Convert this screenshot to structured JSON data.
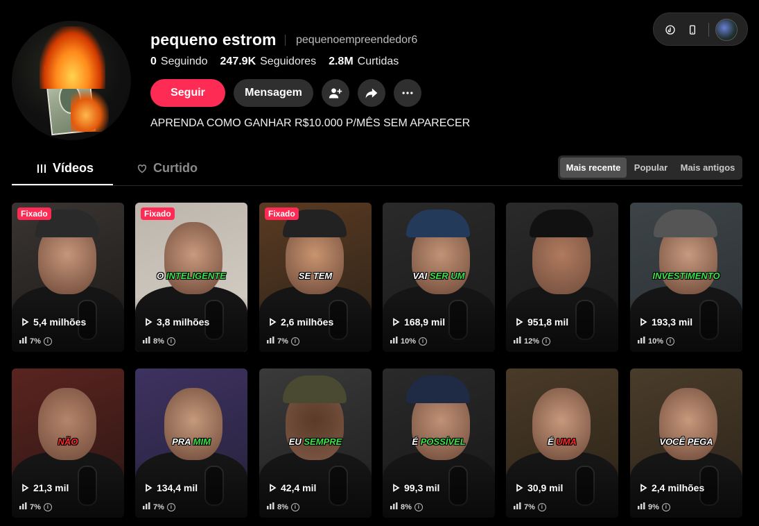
{
  "profile": {
    "name": "pequeno estrom",
    "handle": "pequenoempreendedor6",
    "stats": [
      {
        "value": "0",
        "label": "Seguindo"
      },
      {
        "value": "247.9K",
        "label": "Seguidores"
      },
      {
        "value": "2.8M",
        "label": "Curtidas"
      }
    ],
    "follow_label": "Seguir",
    "message_label": "Mensagem",
    "bio": "APRENDA COMO GANHAR R$10.000 P/MÊS SEM APARECER"
  },
  "tabs": {
    "videos": "Vídeos",
    "liked": "Curtido"
  },
  "sort": {
    "recent": "Mais recente",
    "popular": "Popular",
    "oldest": "Mais antigos"
  },
  "videos": [
    {
      "pinned": "Fixado",
      "caption": [],
      "views": "5,4 milhões",
      "retention": "7%"
    },
    {
      "pinned": "Fixado",
      "caption": [
        {
          "t": "O ",
          "c": "w"
        },
        {
          "t": "INTELIGENTE",
          "c": "g"
        }
      ],
      "views": "3,8 milhões",
      "retention": "8%"
    },
    {
      "pinned": "Fixado",
      "caption": [
        {
          "t": "SE TEM",
          "c": "w"
        }
      ],
      "views": "2,6 milhões",
      "retention": "7%"
    },
    {
      "pinned": "",
      "caption": [
        {
          "t": "VAI ",
          "c": "w"
        },
        {
          "t": "SER UM",
          "c": "g"
        }
      ],
      "views": "168,9 mil",
      "retention": "10%"
    },
    {
      "pinned": "",
      "caption": [],
      "views": "951,8 mil",
      "retention": "12%"
    },
    {
      "pinned": "",
      "caption": [
        {
          "t": "INVESTIMENTO",
          "c": "g"
        }
      ],
      "views": "193,3 mil",
      "retention": "10%"
    },
    {
      "pinned": "",
      "caption": [
        {
          "t": "NÃO",
          "c": "r"
        }
      ],
      "views": "21,3 mil",
      "retention": "7%"
    },
    {
      "pinned": "",
      "caption": [
        {
          "t": "PRA ",
          "c": "w"
        },
        {
          "t": "MIM",
          "c": "g"
        }
      ],
      "views": "134,4 mil",
      "retention": "7%"
    },
    {
      "pinned": "",
      "caption": [
        {
          "t": "EU ",
          "c": "w"
        },
        {
          "t": "SEMPRE",
          "c": "g"
        }
      ],
      "views": "42,4 mil",
      "retention": "8%"
    },
    {
      "pinned": "",
      "caption": [
        {
          "t": "É ",
          "c": "w"
        },
        {
          "t": "POSSÍVEL",
          "c": "g"
        }
      ],
      "views": "99,3 mil",
      "retention": "8%"
    },
    {
      "pinned": "",
      "caption": [
        {
          "t": "É ",
          "c": "w"
        },
        {
          "t": "UMA",
          "c": "r"
        }
      ],
      "views": "30,9 mil",
      "retention": "7%"
    },
    {
      "pinned": "",
      "caption": [
        {
          "t": "VOCÊ PEGA",
          "c": "w"
        }
      ],
      "views": "2,4 milhões",
      "retention": "9%"
    }
  ],
  "colors": {
    "accent": "#fe2c55",
    "caption_green": "#3ee24a",
    "caption_red": "#ff2b2b"
  }
}
